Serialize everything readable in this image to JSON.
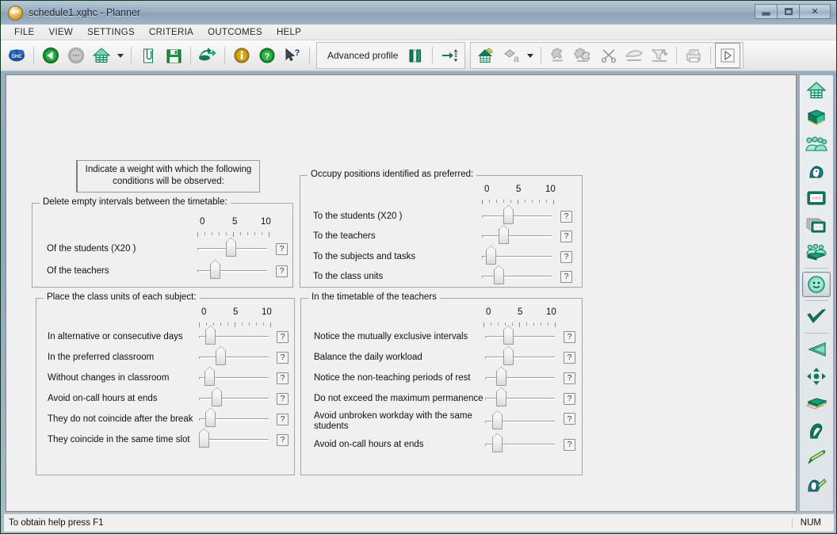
{
  "window": {
    "title": "schedule1.xghc - Planner",
    "app_icon": "ghc-logo-icon",
    "controls": {
      "minimize": "minimize",
      "maximize": "maximize",
      "close": "✕"
    }
  },
  "menubar": {
    "items": [
      {
        "label": "FILE"
      },
      {
        "label": "VIEW"
      },
      {
        "label": "SETTINGS"
      },
      {
        "label": "CRITERIA"
      },
      {
        "label": "OUTCOMES"
      },
      {
        "label": "HELP"
      }
    ]
  },
  "toolbar": {
    "left_buttons": [
      {
        "name": "ghc-logo-icon",
        "title": "GHC"
      },
      {
        "name": "back-arrow-icon",
        "title": "Back"
      },
      {
        "name": "forward-arrow-icon",
        "title": "Forward"
      },
      {
        "name": "home-icon",
        "title": "Home"
      },
      {
        "name": "chevron-down-icon",
        "title": "Home menu"
      },
      {
        "name": "open-file-icon",
        "title": "Open"
      },
      {
        "name": "save-icon",
        "title": "Save"
      },
      {
        "name": "export-icon",
        "title": "Export"
      },
      {
        "name": "info-icon",
        "title": "Information"
      },
      {
        "name": "help-circle-icon",
        "title": "Help"
      },
      {
        "name": "context-help-icon",
        "title": "Context help"
      }
    ],
    "profile": {
      "label": "Advanced profile",
      "icon": "books-icon",
      "sort_icon": "sort-arrow-icon"
    },
    "right_buttons": [
      {
        "name": "home-paint-icon",
        "title": "Design"
      },
      {
        "name": "eraser-a-icon",
        "title": "Erase"
      },
      {
        "name": "chevron-down-icon",
        "title": "Erase menu"
      },
      {
        "name": "puzzle-piece-icon",
        "title": "Add piece"
      },
      {
        "name": "puzzle-pieces-icon",
        "title": "Add pieces"
      },
      {
        "name": "scissors-icon",
        "title": "Cut"
      },
      {
        "name": "hand-icon",
        "title": "Hand"
      },
      {
        "name": "funnel-icon",
        "title": "Filter"
      },
      {
        "name": "print-icon",
        "title": "Print"
      },
      {
        "name": "play-icon",
        "title": "Run"
      }
    ]
  },
  "sidebar": {
    "items": [
      {
        "name": "sidebar-item-home",
        "icon": "house-grid-icon",
        "selected": false
      },
      {
        "name": "sidebar-item-subjects",
        "icon": "book-icon",
        "selected": false
      },
      {
        "name": "sidebar-item-groups",
        "icon": "people-group-icon",
        "selected": false
      },
      {
        "name": "sidebar-item-teacher",
        "icon": "person-icon",
        "selected": false
      },
      {
        "name": "sidebar-item-classroom",
        "icon": "window-icon",
        "selected": false
      },
      {
        "name": "sidebar-item-classrooms",
        "icon": "stacked-windows-icon",
        "selected": false
      },
      {
        "name": "sidebar-item-class-units",
        "icon": "group-book-icon",
        "selected": false
      },
      {
        "name": "sidebar-item-criteria",
        "icon": "smiley-icon",
        "selected": true
      },
      {
        "name": "sidebar-item-validate",
        "icon": "check-icon",
        "selected": false
      },
      {
        "name": "sidebar-item-announce",
        "icon": "megaphone-icon",
        "selected": false
      },
      {
        "name": "sidebar-item-move",
        "icon": "move-arrows-icon",
        "selected": false
      },
      {
        "name": "sidebar-item-library",
        "icon": "books-stack-icon",
        "selected": false
      },
      {
        "name": "sidebar-item-hand",
        "icon": "hand-icon",
        "selected": false
      },
      {
        "name": "sidebar-item-edit",
        "icon": "pencil-icon",
        "selected": false
      },
      {
        "name": "sidebar-item-person-edit",
        "icon": "person-pencil-icon",
        "selected": false
      }
    ]
  },
  "form": {
    "hint": "Indicate a weight with which the following conditions will be observed:",
    "scale_labels": [
      "0",
      "5",
      "10"
    ],
    "help_label": "?",
    "groups": [
      {
        "name": "delete-empty-intervals",
        "title": "Delete empty intervals between the timetable:",
        "rows": [
          {
            "label": "Of the students  (X20 )",
            "value": 4.3
          },
          {
            "label": "Of the teachers",
            "value": 2.0
          }
        ]
      },
      {
        "name": "occupy-preferred-positions",
        "title": "Occupy positions identified as preferred:",
        "rows": [
          {
            "label": "To the students  (X20 )",
            "value": 3.3
          },
          {
            "label": "To the teachers",
            "value": 2.6
          },
          {
            "label": "To the subjects and tasks",
            "value": 1.0
          },
          {
            "label": "To the class units",
            "value": 1.8
          }
        ]
      },
      {
        "name": "place-class-units",
        "title": "Place the class units of each subject:",
        "rows": [
          {
            "label": "In alternative or consecutive days",
            "value": 1.0
          },
          {
            "label": "In the preferred classroom",
            "value": 2.5
          },
          {
            "label": "Without changes in classroom",
            "value": 1.0
          },
          {
            "label": "Avoid on-call hours at ends",
            "value": 2.0
          },
          {
            "label": "They do not coincide after the break",
            "value": 1.0
          },
          {
            "label": "They coincide in the same time slot",
            "value": 0.0
          }
        ]
      },
      {
        "name": "teachers-timetable",
        "title": "In the timetable of the teachers",
        "rows": [
          {
            "label": "Notice the mutually exclusive intervals",
            "value": 2.8
          },
          {
            "label": "Balance the daily workload",
            "value": 2.8
          },
          {
            "label": "Notice the non-teaching periods of rest",
            "value": 1.8
          },
          {
            "label": "Do not exceed the maximum permanence",
            "value": 1.8
          },
          {
            "label": "Avoid unbroken workday with the same students",
            "value": 1.2
          },
          {
            "label": "Avoid on-call hours at ends",
            "value": 1.2
          }
        ]
      }
    ]
  },
  "statusbar": {
    "message": "To obtain help press F1",
    "num_lock": "NUM"
  },
  "colors": {
    "accent_green": "#0f7a5a",
    "accent_blue": "#1c4f9c",
    "panel_bg": "#f0f0f0",
    "title_text": "#14212e"
  }
}
